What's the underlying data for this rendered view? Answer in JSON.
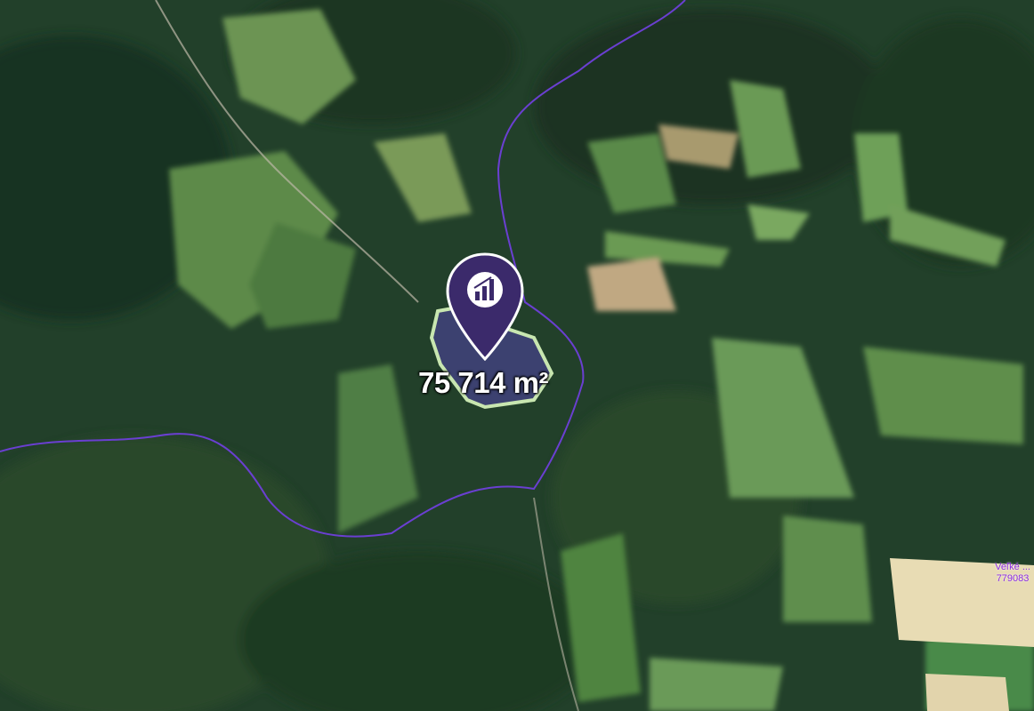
{
  "map": {
    "area_label": "75 714 m²",
    "border_label_line1": "Veľké ...",
    "border_label_line2": "779083",
    "colors": {
      "forest_dark": "#1c3320",
      "forest": "#2a4a2c",
      "meadow": "#5b8a4a",
      "meadow_light": "#7ea45e",
      "field_tan": "#e8dcb4",
      "parcel_fill": "#3a3f6e",
      "parcel_outline": "#c8e6b0",
      "pin": "#3b2a6b",
      "border_line": "#6a3fd1"
    },
    "pin_icon": "chart-bars-icon"
  }
}
